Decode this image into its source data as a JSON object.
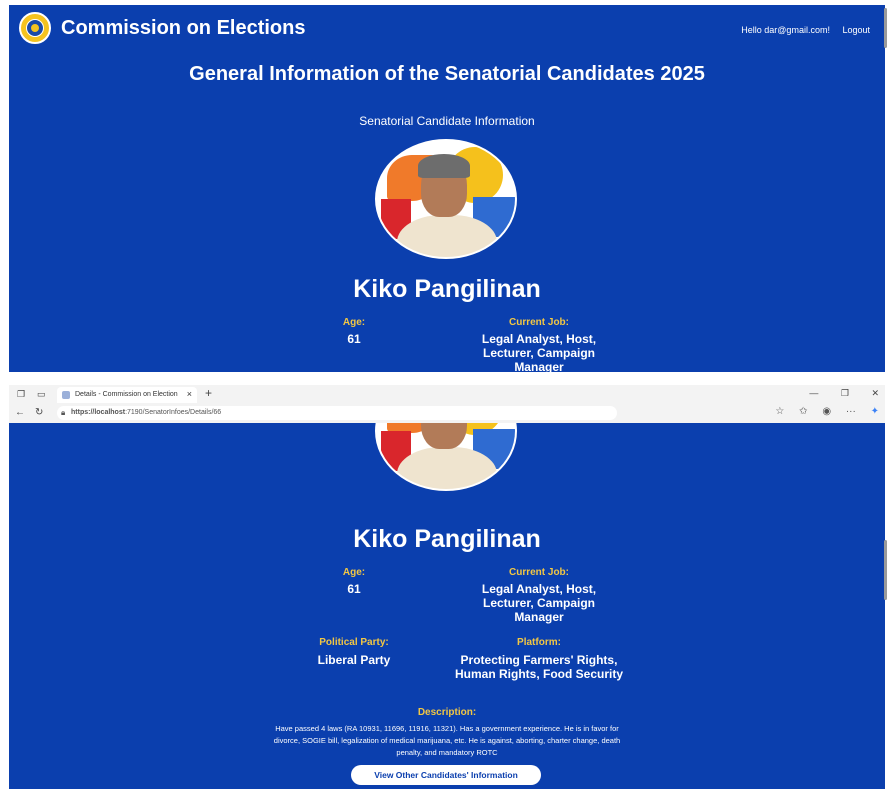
{
  "app": {
    "brand": "Commission on Elections",
    "greeting": "Hello dar@gmail.com!",
    "logout": "Logout",
    "page_title": "General Information of the Senatorial Candidates 2025",
    "section_title": "Senatorial Candidate Information"
  },
  "browser": {
    "tab_title": "Details - Commission on Election",
    "url_host": "https://localhost",
    "url_path": ":7190/SenatorInfoes/Details/66"
  },
  "candidate": {
    "name": "Kiko Pangilinan",
    "age_label": "Age:",
    "age": "61",
    "job_label": "Current Job:",
    "job": "Legal Analyst, Host, Lecturer, Campaign Manager",
    "party_label": "Political Party:",
    "party": "Liberal Party",
    "platform_label": "Platform:",
    "platform": "Protecting Farmers' Rights, Human Rights, Food Security",
    "description_label": "Description:",
    "description": "Have passed 4 laws (RA 10931, 11696, 11916, 11321). Has a government experience. He is in favor for divorce, SOGIE bill, legalization of medical marijuana, etc. He is against, aborting, charter change, death penalty, and mandatory ROTC"
  },
  "actions": {
    "view_others": "View Other Candidates' Information"
  },
  "colors": {
    "background": "#0b3fae",
    "label": "#f2c744",
    "text": "#ffffff"
  }
}
